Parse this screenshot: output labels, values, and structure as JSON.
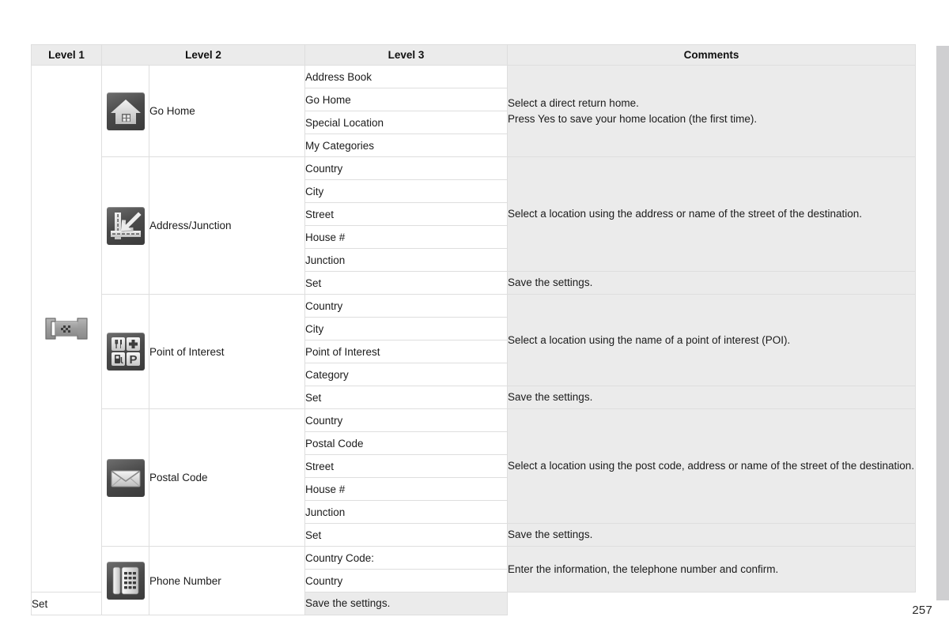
{
  "page": {
    "number": "257"
  },
  "table": {
    "headers": {
      "level1": "Level 1",
      "level2": "Level 2",
      "level3": "Level 3",
      "comments": "Comments"
    },
    "level1": {
      "icon": "destination-flag-icon",
      "label": ""
    },
    "groups": [
      {
        "icon": "home-icon",
        "level2": "Go Home",
        "level3": [
          "Address Book",
          "Go Home",
          "Special Location",
          "My Categories"
        ],
        "comment_lines": [
          "Select a direct return home.",
          "Press Yes to save your home location (the first time)."
        ],
        "set_label": null,
        "set_comment": null
      },
      {
        "icon": "road-junction-icon",
        "level2": "Address/Junction",
        "level3": [
          "Country",
          "City",
          "Street",
          "House #",
          "Junction"
        ],
        "comment_lines": [
          "Select a location using the address or name of the street of the destination."
        ],
        "set_label": "Set",
        "set_comment": "Save the settings."
      },
      {
        "icon": "poi-grid-icon",
        "level2": "Point of Interest",
        "level3": [
          "Country",
          "City",
          "Point of Interest",
          "Category"
        ],
        "comment_lines": [
          "Select a location using the name of a point of interest (POI)."
        ],
        "set_label": "Set",
        "set_comment": "Save the settings."
      },
      {
        "icon": "envelope-icon",
        "level2": "Postal Code",
        "level3": [
          "Country",
          "Postal Code",
          "Street",
          "House #",
          "Junction"
        ],
        "comment_lines": [
          "Select a location using the post code, address or name of the street of the destination."
        ],
        "set_label": "Set",
        "set_comment": "Save the settings."
      },
      {
        "icon": "telephone-icon",
        "level2": "Phone Number",
        "level3": [
          "Country Code:",
          "Country"
        ],
        "comment_lines": [
          "Enter the information, the telephone number and confirm."
        ],
        "set_label": "Set",
        "set_comment": "Save the settings."
      }
    ]
  },
  "colors": {
    "header_bg": "#ebebeb",
    "comment_bg": "#ebebeb",
    "cell_bg": "#ffffff",
    "border": "#dedede",
    "side_tab": "#cfcfd1",
    "text": "#1b1b1b"
  }
}
